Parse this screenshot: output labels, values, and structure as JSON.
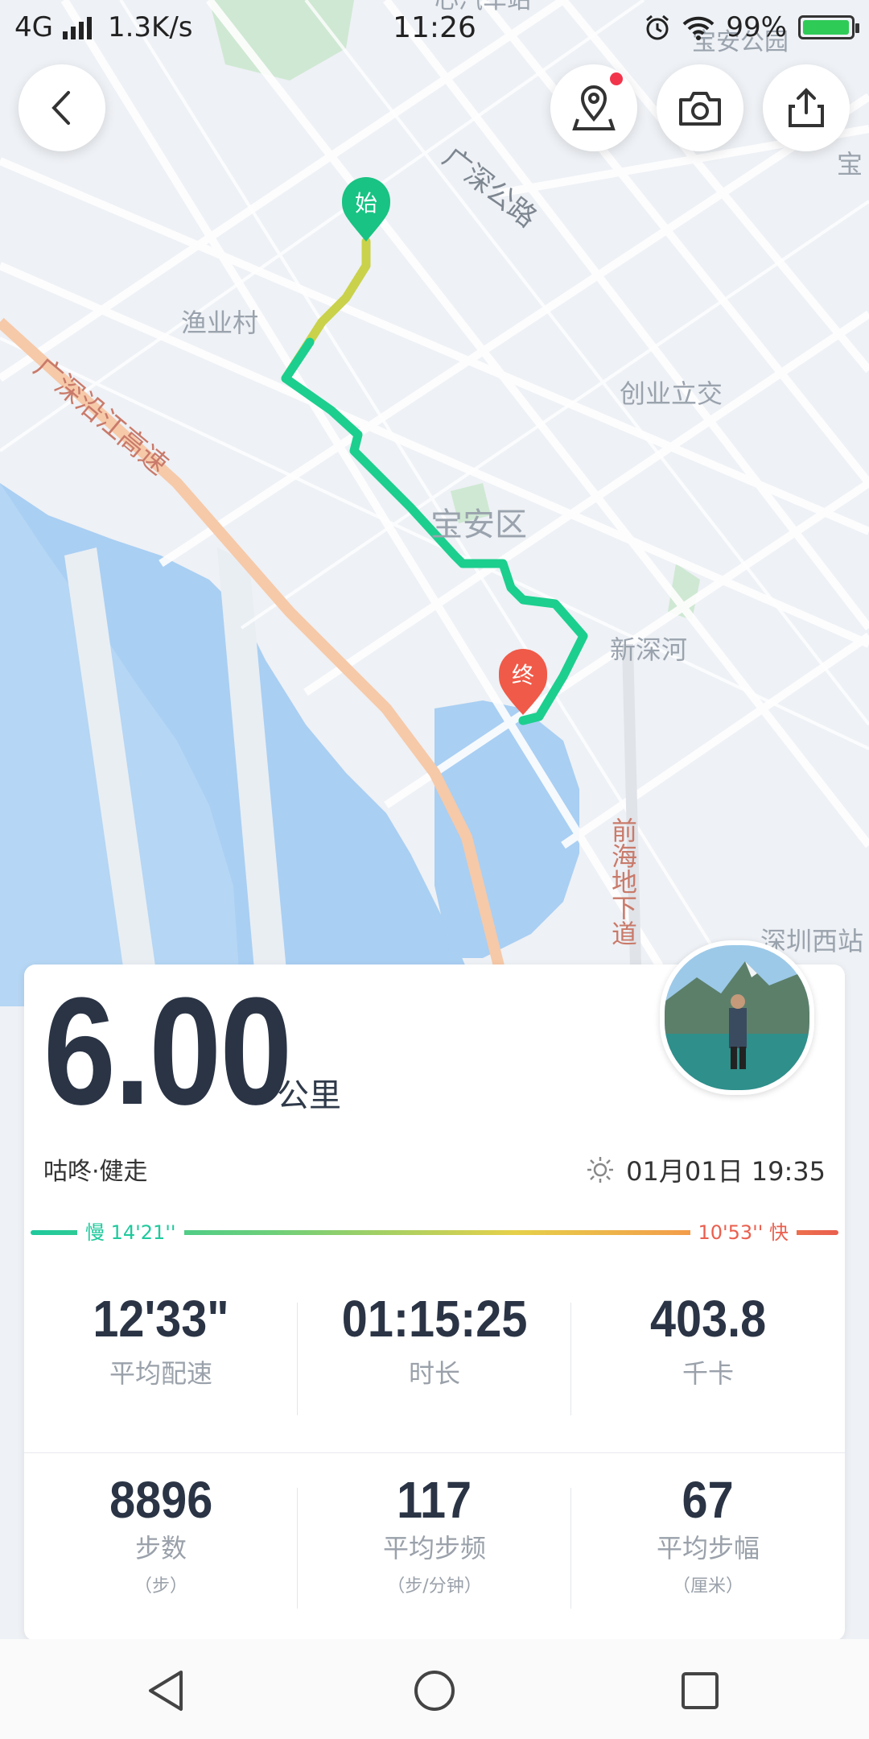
{
  "status_bar": {
    "network": "4G",
    "speed": "1.3K/s",
    "time": "11:26",
    "battery": "99%",
    "battery_level": 0.99
  },
  "map": {
    "labels": {
      "station_top": "心汽车站",
      "park_top": "宝安公园",
      "guangshen_road": "广深公路",
      "yuye_village": "渔业村",
      "expressway": "广深沿江高速",
      "chuangye": "创业立交",
      "baoan": "宝安区",
      "xinshenhe": "新深河",
      "qianhai_tunnel": "前海地下道",
      "shenzhen_west": "深圳西站",
      "bao_right": "宝"
    },
    "start_marker": "始",
    "end_marker": "终",
    "colors": {
      "route_start": "#c9d24a",
      "route": "#1ccf8f",
      "start_pin": "#18c383",
      "end_pin": "#f05a48"
    }
  },
  "buttons": {
    "back": "back",
    "location": "location",
    "camera": "camera",
    "share": "share"
  },
  "summary": {
    "distance": "6.00",
    "distance_unit": "公里",
    "activity": "咕咚·健走",
    "datetime": "01月01日 19:35",
    "pace_slow": "慢 14'21''",
    "pace_fast": "10'53'' 快"
  },
  "stats": [
    {
      "value": "12'33\"",
      "label": "平均配速"
    },
    {
      "value": "01:15:25",
      "label": "时长"
    },
    {
      "value": "403.8",
      "label": "千卡"
    },
    {
      "value": "8896",
      "label": "步数",
      "sub": "（步）"
    },
    {
      "value": "117",
      "label": "平均步频",
      "sub": "（步/分钟）"
    },
    {
      "value": "67",
      "label": "平均步幅",
      "sub": "（厘米）"
    }
  ],
  "colors": {
    "pace_slow": "#1fc99c",
    "pace_fast": "#ea5f4e",
    "accent": "#1ccf8f"
  }
}
